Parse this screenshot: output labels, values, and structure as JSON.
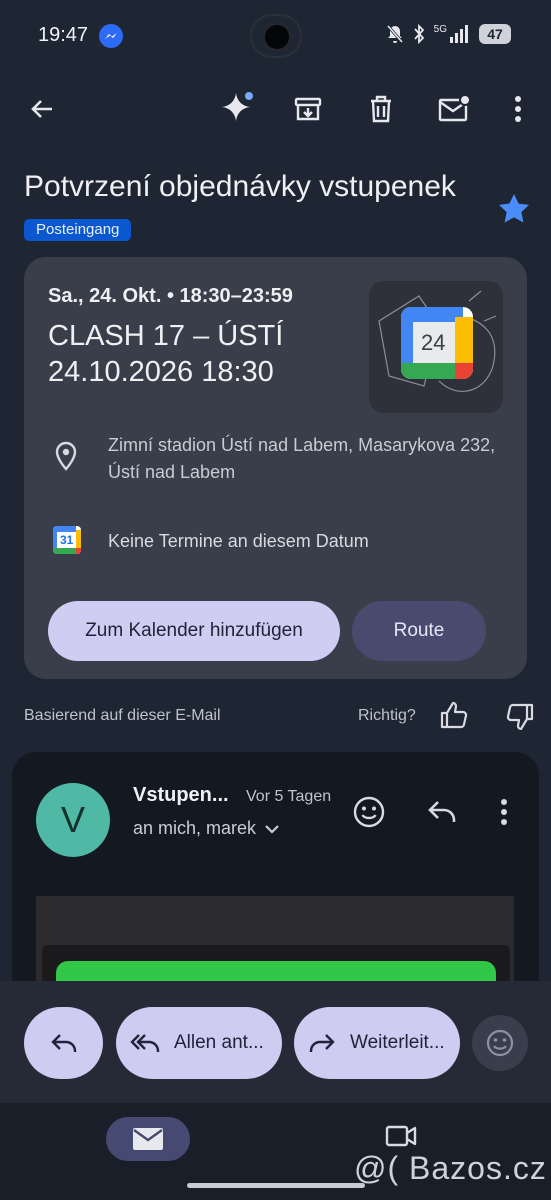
{
  "status_bar": {
    "time": "19:47",
    "network": "5G",
    "battery": "47"
  },
  "toolbar": {
    "icons": [
      "back-arrow-icon",
      "gemini-sparkle-icon",
      "archive-icon",
      "delete-icon",
      "mark-unread-icon",
      "more-vert-icon"
    ]
  },
  "email": {
    "subject": "Potvrzení objednávky vstupenek",
    "label": "Posteingang"
  },
  "event_card": {
    "datetime": "Sa., 24. Okt. • 18:30–23:59",
    "title": "CLASH 17 – ÚSTÍ 24.10.2026 18:30",
    "illustration_day": "24",
    "location": "Zimní stadion Ústí nad Labem, Masarykova 232, Ústí nad Labem",
    "calendar_icon_day": "31",
    "calendar_status": "Keine Termine an diesem Datum",
    "add_to_calendar_label": "Zum Kalender hinzufügen",
    "route_label": "Route"
  },
  "feedback": {
    "based_on": "Basierend auf dieser E-Mail",
    "question": "Richtig?"
  },
  "message": {
    "avatar_letter": "V",
    "sender": "Vstupen...",
    "time": "Vor 5 Tagen",
    "recipients": "an mich, marek"
  },
  "reply_bar": {
    "reply_all_label": "Allen ant...",
    "forward_label": "Weiterleit..."
  },
  "watermark": "@( Bazos.cz",
  "colors": {
    "background": "#1f2633",
    "card": "#3a3e4a",
    "accent_chip": "#0b57d0",
    "pill_primary": "#d0cdf3",
    "pill_secondary": "#4a4a6e",
    "avatar": "#4fb9a6",
    "star": "#4b8df8",
    "banner_green": "#33c748"
  }
}
